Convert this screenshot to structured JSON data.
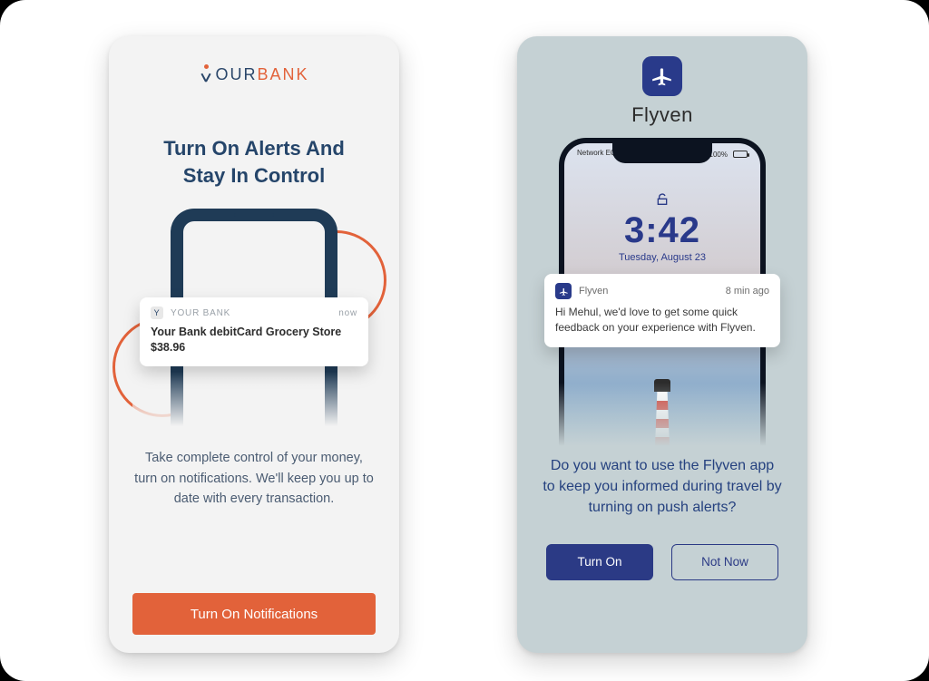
{
  "bank": {
    "brand_word1": "OUR",
    "brand_word2": "BANK",
    "title": "Turn On Alerts And Stay In Control",
    "notif": {
      "app": "YOUR BANK",
      "time": "now",
      "line1": "Your Bank debitCard Grocery Store",
      "line2": "$38.96"
    },
    "description": "Take complete control of your money, turn on notifications. We'll keep you up to date with every transaction.",
    "cta": "Turn On Notifications"
  },
  "flyven": {
    "brand_name": "Flyven",
    "statusbar": {
      "carrier": "Network EQ",
      "battery_pct": "100%"
    },
    "lockscreen": {
      "time": "3:42",
      "date": "Tuesday, August 23"
    },
    "notif": {
      "app": "Flyven",
      "time": "8 min ago",
      "body": "Hi Mehul, we'd love to get some quick feedback on your experience with Flyven."
    },
    "question": "Do you want to use the Flyven app to keep you informed during travel by turning on push alerts?",
    "primary": "Turn On",
    "secondary": "Not Now"
  }
}
